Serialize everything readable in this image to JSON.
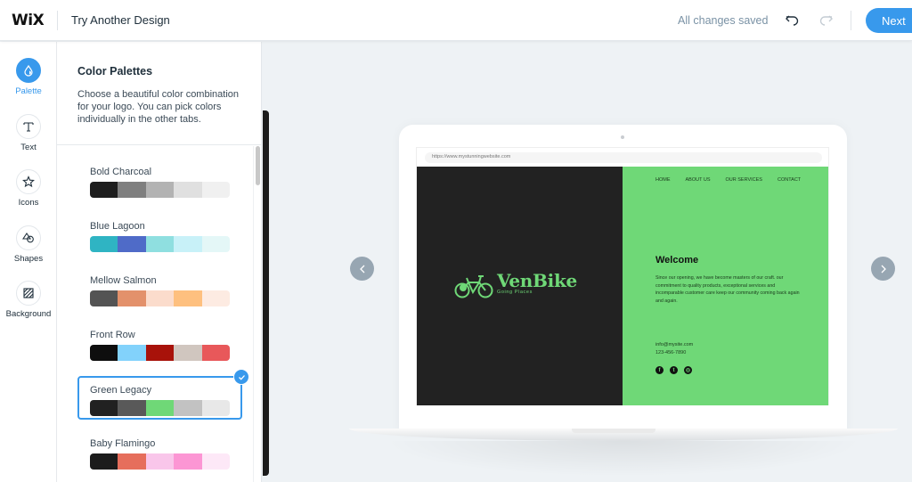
{
  "header": {
    "logo": "WiX",
    "title": "Try Another Design",
    "status": "All changes saved",
    "undo_icon": "undo-icon",
    "redo_icon": "redo-icon",
    "next_label": "Next",
    "accent_color": "#3899ec"
  },
  "rail": {
    "items": [
      {
        "label": "Palette",
        "icon": "droplet-icon",
        "active": true
      },
      {
        "label": "Text",
        "icon": "text-t-icon",
        "active": false
      },
      {
        "label": "Icons",
        "icon": "star-icon",
        "active": false
      },
      {
        "label": "Shapes",
        "icon": "shapes-icon",
        "active": false
      },
      {
        "label": "Background",
        "icon": "hatched-square-icon",
        "active": false
      }
    ]
  },
  "panel": {
    "title": "Color Palettes",
    "description": "Choose a beautiful color combination for your logo. You can pick colors individually in the other tabs.",
    "palettes": [
      {
        "name": "Bold Charcoal",
        "colors": [
          "#1e1e1e",
          "#7f7f7f",
          "#b3b3b3",
          "#e0e0e0",
          "#f0f0f0"
        ],
        "selected": false
      },
      {
        "name": "Blue Lagoon",
        "colors": [
          "#2fb4c3",
          "#4f6bc8",
          "#8fdfe0",
          "#c8f1f8",
          "#e4f7f7"
        ],
        "selected": false
      },
      {
        "name": "Mellow Salmon",
        "colors": [
          "#545454",
          "#e3916b",
          "#fbdccc",
          "#fec07f",
          "#fdebe2"
        ],
        "selected": false
      },
      {
        "name": "Front Row",
        "colors": [
          "#0e0e0e",
          "#82d2fb",
          "#a8120a",
          "#d0c6bf",
          "#e8585a"
        ],
        "selected": false
      },
      {
        "name": "Green Legacy",
        "colors": [
          "#212121",
          "#595959",
          "#6fd877",
          "#c2c2c2",
          "#e8e8e8"
        ],
        "selected": true
      },
      {
        "name": "Baby Flamingo",
        "colors": [
          "#1c1c1c",
          "#e66e5c",
          "#f9c6ea",
          "#fc96d4",
          "#fde8f7"
        ],
        "selected": false
      }
    ]
  },
  "preview": {
    "url": "https://www.mystunningwebsite.com",
    "brand_name": "VenBike",
    "brand_tagline": "Going Places",
    "nav": [
      "HOME",
      "ABOUT US",
      "OUR SERVICES",
      "CONTACT"
    ],
    "welcome_title": "Welcome",
    "welcome_text": "Since our opening, we have become masters of our craft. our commitment to quality products, exceptional services and incomparable customer care keep our community coming back again and again.",
    "email": "info@mysite.com",
    "phone": "123-456-7890",
    "socials": [
      "facebook-icon",
      "twitter-icon",
      "instagram-icon"
    ],
    "left_bg": "#222222",
    "right_bg": "#6fd877",
    "prev_icon": "chevron-left-icon",
    "next_icon": "chevron-right-icon"
  }
}
